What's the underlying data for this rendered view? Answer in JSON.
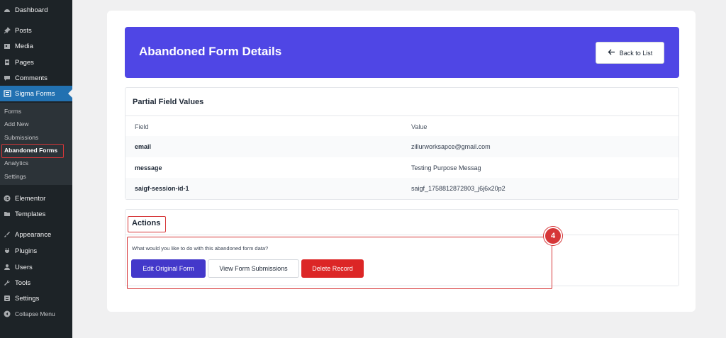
{
  "sidebar": {
    "items": [
      {
        "label": "Dashboard",
        "icon": "dashboard-icon"
      },
      {
        "label": "Posts",
        "icon": "pin-icon"
      },
      {
        "label": "Media",
        "icon": "media-icon"
      },
      {
        "label": "Pages",
        "icon": "pages-icon"
      },
      {
        "label": "Comments",
        "icon": "comment-icon"
      },
      {
        "label": "Sigma Forms",
        "icon": "form-icon"
      },
      {
        "label": "Elementor",
        "icon": "elementor-icon"
      },
      {
        "label": "Templates",
        "icon": "folder-icon"
      },
      {
        "label": "Appearance",
        "icon": "brush-icon"
      },
      {
        "label": "Plugins",
        "icon": "plugin-icon"
      },
      {
        "label": "Users",
        "icon": "user-icon"
      },
      {
        "label": "Tools",
        "icon": "wrench-icon"
      },
      {
        "label": "Settings",
        "icon": "settings-icon"
      },
      {
        "label": "Collapse Menu",
        "icon": "collapse-icon"
      }
    ],
    "submenu": [
      "Forms",
      "Add New",
      "Submissions",
      "Abandoned Forms",
      "Analytics",
      "Settings"
    ]
  },
  "header": {
    "title": "Abandoned Form Details",
    "back_label": "Back to List"
  },
  "fields_panel": {
    "title": "Partial Field Values",
    "columns": [
      "Field",
      "Value"
    ],
    "rows": [
      {
        "field": "email",
        "value": "zillurworksapce@gmail.com"
      },
      {
        "field": "message",
        "value": "Testing Purpose Messag"
      },
      {
        "field": "saigf-session-id-1",
        "value": "saigf_1758812872803_j6j6x20p2"
      }
    ]
  },
  "actions": {
    "title": "Actions",
    "question": "What would you like to do with this abandoned form data?",
    "edit_label": "Edit Original Form",
    "view_label": "View Form Submissions",
    "delete_label": "Delete Record",
    "step_badge": "4"
  },
  "colors": {
    "sidebar_bg": "#1d2327",
    "active_menu": "#2271b1",
    "banner": "#4f46e5",
    "edit_button": "#4338ca",
    "delete_button": "#dc2626",
    "highlight": "#d63638"
  }
}
